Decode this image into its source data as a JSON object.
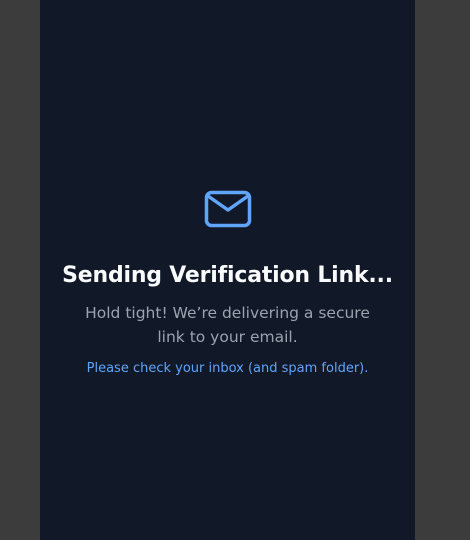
{
  "panel": {
    "icon": "envelope-icon",
    "title": "Sending Verification Link...",
    "subtitle": "Hold tight! We’re delivering a secure link to your email.",
    "hint": "Please check your inbox (and spam folder)."
  },
  "colors": {
    "page_background": "#3c3c3c",
    "panel_background": "#111827",
    "accent": "#60a5fa",
    "title": "#f9fafb",
    "subtitle": "#9ca3af"
  }
}
